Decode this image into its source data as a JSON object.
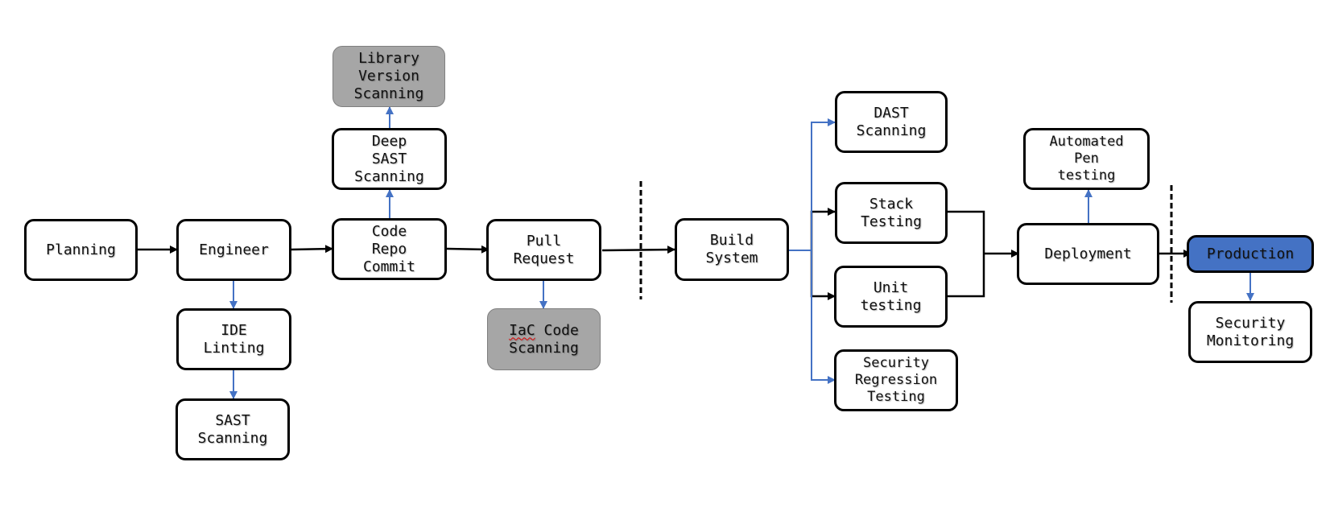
{
  "diagram": {
    "nodes": {
      "planning": "Planning",
      "engineer": "Engineer",
      "ide_linting": "IDE\nLinting",
      "sast_scanning": "SAST\nScanning",
      "code_repo_commit": "Code\nRepo\nCommit",
      "deep_sast_scanning": "Deep\nSAST\nScanning",
      "library_version_scanning": "Library\nVersion\nScanning",
      "pull_request": "Pull\nRequest",
      "iac_code_scanning_word1": "IaC",
      "iac_code_scanning_rest": " Code\nScanning",
      "build_system": "Build\nSystem",
      "dast_scanning": "DAST\nScanning",
      "stack_testing": "Stack\nTesting",
      "unit_testing": "Unit\ntesting",
      "security_regression_testing": "Security\nRegression\nTesting",
      "automated_pen_testing": "Automated\nPen\ntesting",
      "deployment": "Deployment",
      "production": "Production",
      "security_monitoring": "Security\nMonitoring"
    },
    "edges": [
      {
        "from": "planning",
        "to": "engineer",
        "style": "main"
      },
      {
        "from": "engineer",
        "to": "code_repo_commit",
        "style": "main"
      },
      {
        "from": "code_repo_commit",
        "to": "pull_request",
        "style": "main"
      },
      {
        "from": "pull_request",
        "to": "build_system",
        "style": "main"
      },
      {
        "from": "build_system",
        "to": "stack_testing",
        "style": "main"
      },
      {
        "from": "build_system",
        "to": "unit_testing",
        "style": "main"
      },
      {
        "from": "stack_testing",
        "to": "deployment",
        "style": "main"
      },
      {
        "from": "unit_testing",
        "to": "deployment",
        "style": "main"
      },
      {
        "from": "deployment",
        "to": "production",
        "style": "main"
      },
      {
        "from": "engineer",
        "to": "ide_linting",
        "style": "security"
      },
      {
        "from": "ide_linting",
        "to": "sast_scanning",
        "style": "security"
      },
      {
        "from": "code_repo_commit",
        "to": "deep_sast_scanning",
        "style": "security"
      },
      {
        "from": "deep_sast_scanning",
        "to": "library_version_scanning",
        "style": "security"
      },
      {
        "from": "pull_request",
        "to": "iac_code_scanning",
        "style": "security"
      },
      {
        "from": "build_system",
        "to": "dast_scanning",
        "style": "security"
      },
      {
        "from": "build_system",
        "to": "security_regression_testing",
        "style": "security"
      },
      {
        "from": "deployment",
        "to": "automated_pen_testing",
        "style": "security"
      },
      {
        "from": "production",
        "to": "security_monitoring",
        "style": "security"
      }
    ],
    "colors": {
      "main_edge": "#000000",
      "security_edge": "#4472c4",
      "highlight_fill": "#4472c4",
      "gray_fill": "#a6a6a6"
    }
  }
}
